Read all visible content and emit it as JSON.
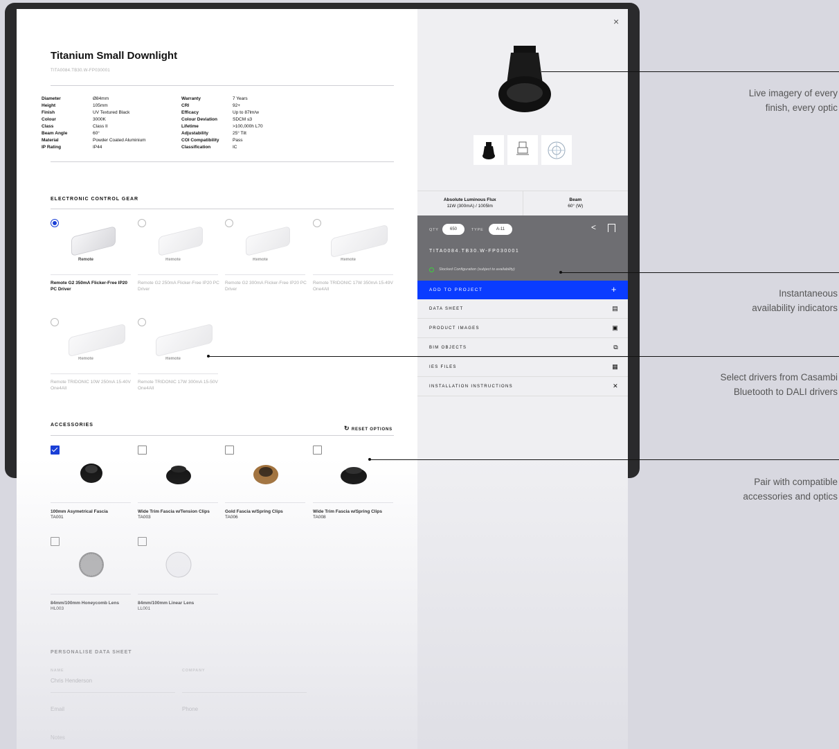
{
  "product": {
    "title": "Titanium Small Downlight",
    "code": "TITA0084.TB30.W-FP030001",
    "specs_left": [
      {
        "k": "Diameter",
        "v": "Ø84mm"
      },
      {
        "k": "Height",
        "v": "105mm"
      },
      {
        "k": "Finish",
        "v": "UV Textured Black"
      },
      {
        "k": "Colour",
        "v": "3000K"
      },
      {
        "k": "Class",
        "v": "Class II"
      },
      {
        "k": "Beam Angle",
        "v": "60°"
      },
      {
        "k": "Material",
        "v": "Powder Coated Aluminium"
      },
      {
        "k": "IP Rating",
        "v": "IP44"
      }
    ],
    "specs_right": [
      {
        "k": "Warranty",
        "v": "7 Years"
      },
      {
        "k": "CRI",
        "v": "92+"
      },
      {
        "k": "Efficacy",
        "v": "Up to 87lm/w"
      },
      {
        "k": "Colour Deviation",
        "v": "SDCM ≤3"
      },
      {
        "k": "Lifetime",
        "v": ">100,000h L70"
      },
      {
        "k": "Adjustability",
        "v": "25° Tilt"
      },
      {
        "k": "COI Compatibility",
        "v": "Pass"
      },
      {
        "k": "Classification",
        "v": "IC"
      }
    ]
  },
  "gear": {
    "title": "ELECTRONIC CONTROL GEAR",
    "brand": "Remote",
    "items": [
      {
        "label": "Remote G2 350mA Flicker-Free IP20 PC Driver"
      },
      {
        "label": "Remote G2 250mA Flicker-Free IP20 PC Driver"
      },
      {
        "label": "Remote G2 300mA Flicker-Free IP20 PC Driver"
      },
      {
        "label": "Remote TRIDONIC 17W 350mA 15-49V One4All"
      },
      {
        "label": "Remote TRIDONIC 10W 250mA 15-40V One4All"
      },
      {
        "label": "Remote TRIDONIC 17W 300mA 15-50V One4All"
      }
    ]
  },
  "accessories": {
    "title": "ACCESSORIES",
    "reset": "RESET OPTIONS",
    "items": [
      {
        "label": "100mm Asymetrical Fascia",
        "code": "TA001"
      },
      {
        "label": "Wide Trim Fascia w/Tension Clips",
        "code": "TA003"
      },
      {
        "label": "Gold Fascia w/Spring Clips",
        "code": "TA006"
      },
      {
        "label": "Wide Trim Fascia w/Spring Clips",
        "code": "TA008"
      },
      {
        "label": "84mm/100mm Honeycomb Lens",
        "code": "HL003"
      },
      {
        "label": "84mm/100mm Linear Lens",
        "code": "LL001"
      }
    ]
  },
  "personalise": {
    "title": "PERSONALISE DATA SHEET",
    "name_label": "NAME",
    "name_value": "Chris Henderson",
    "company_label": "COMPANY",
    "email_placeholder": "Email",
    "phone_placeholder": "Phone",
    "notes_placeholder": "Notes"
  },
  "panel": {
    "close": "×",
    "stat1_label": "Absolute Luminous Flux",
    "stat1_value": "11W (300mA) / 1005lm",
    "stat2_label": "Beam",
    "stat2_value": "60° (W)",
    "qty_label": "QTY",
    "qty_value": "650",
    "type_label": "TYPE",
    "type_value": "A-11",
    "config_code": "TITA0084.TB30.W-FP030001",
    "stock_text": "Stocked Configuration (subject to availability)",
    "add_label": "ADD TO PROJECT",
    "add_icon": "+",
    "menu": [
      {
        "label": "DATA SHEET"
      },
      {
        "label": "PRODUCT IMAGES"
      },
      {
        "label": "BIM OBJECTS"
      },
      {
        "label": "IES FILES"
      },
      {
        "label": "INSTALLATION INSTRUCTIONS"
      }
    ]
  },
  "callouts": [
    {
      "l1": "Live imagery of every",
      "l2": "finish, every optic"
    },
    {
      "l1": "Instantaneous",
      "l2": "availability indicators"
    },
    {
      "l1": "Select drivers from Casambi",
      "l2": "Bluetooth to DALI drivers"
    },
    {
      "l1": "Pair with compatible",
      "l2": "accessories and optics"
    }
  ],
  "colors": {
    "accent": "#0a3cff",
    "stock_ok": "#3cd23c",
    "panel_grey": "#6e6e72"
  }
}
